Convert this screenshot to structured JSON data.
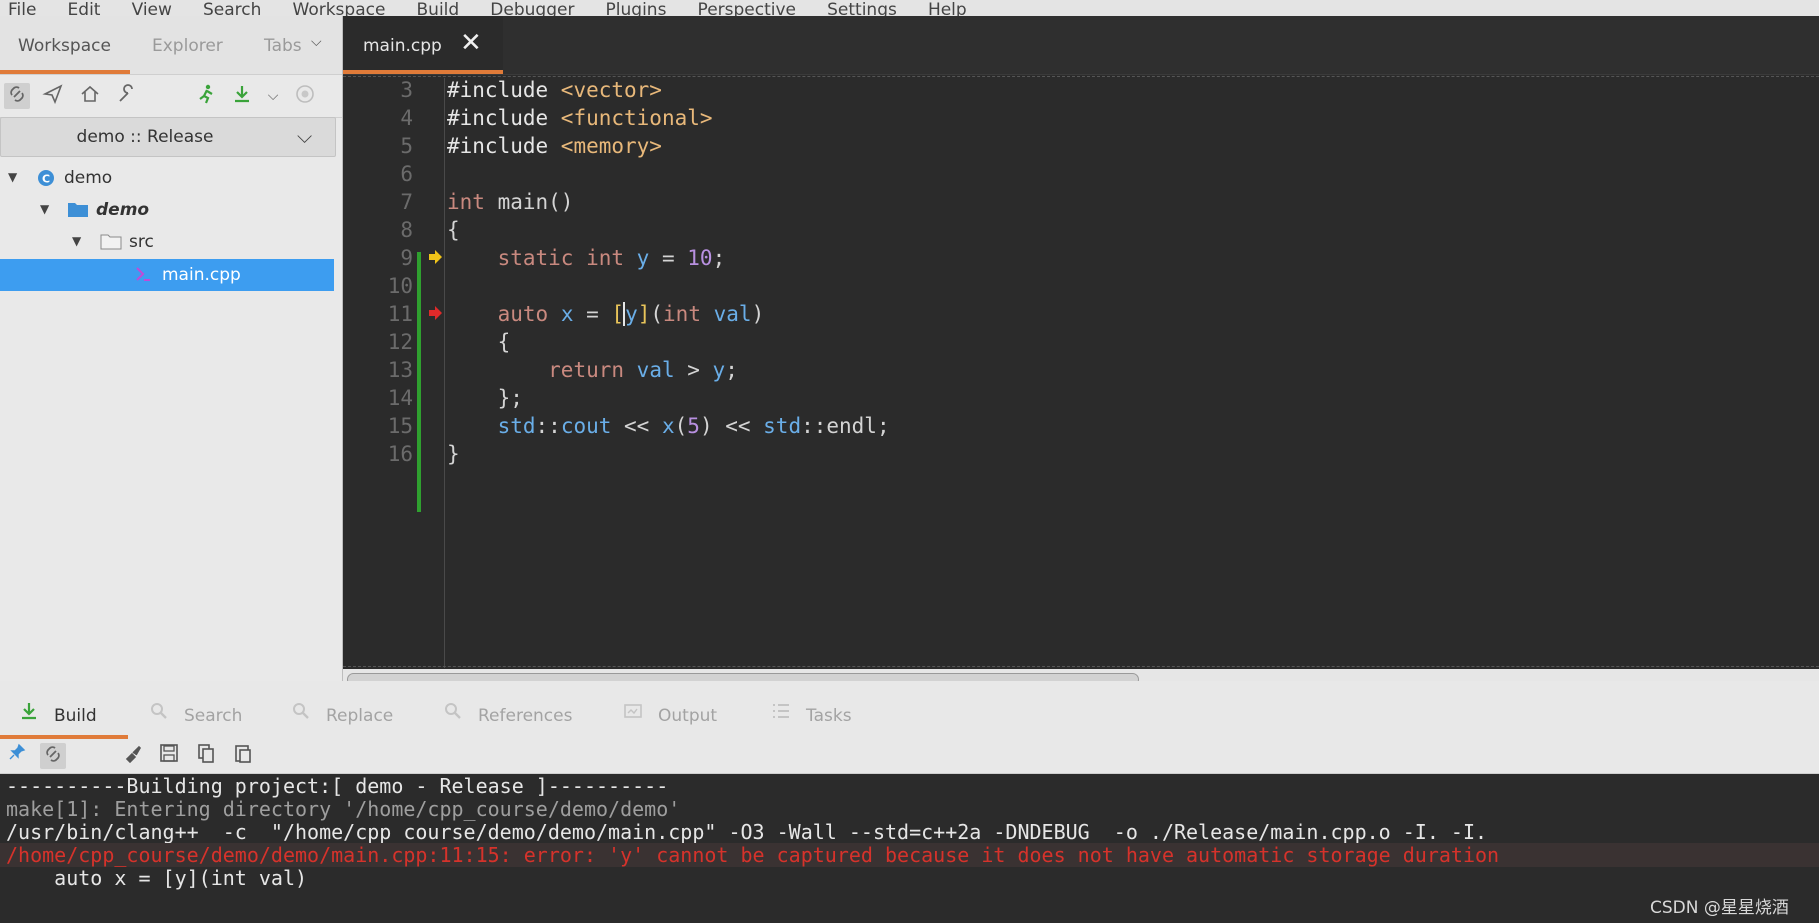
{
  "menu": [
    "File",
    "Edit",
    "View",
    "Search",
    "Workspace",
    "Build",
    "Debugger",
    "Plugins",
    "Perspective",
    "Settings",
    "Help"
  ],
  "left_panel": {
    "tabs": [
      "Workspace",
      "Explorer",
      "Tabs"
    ],
    "config": "demo :: Release",
    "tree": [
      {
        "label": "demo",
        "icon": "workspace-icon"
      },
      {
        "label": "demo",
        "icon": "project-folder-icon"
      },
      {
        "label": "src",
        "icon": "folder-icon"
      },
      {
        "label": "main.cpp",
        "icon": "cpp-file-icon"
      }
    ]
  },
  "editor": {
    "tab_label": "main.cpp",
    "line_numbers": [
      "3",
      "4",
      "5",
      "6",
      "7",
      "8",
      "9",
      "10",
      "11",
      "12",
      "13",
      "14",
      "15",
      "16"
    ]
  },
  "bottom_panel": {
    "tabs": [
      "Build",
      "Search",
      "Replace",
      "References",
      "Output",
      "Tasks"
    ],
    "output": [
      "----------Building project:[ demo - Release ]----------",
      "make[1]: Entering directory '/home/cpp_course/demo/demo'",
      "/usr/bin/clang++  -c  \"/home/cpp_course/demo/demo/main.cpp\" -O3 -Wall --std=c++2a -DNDEBUG  -o ./Release/main.cpp.o -I. -I.",
      "/home/cpp_course/demo/demo/main.cpp:11:15: error: 'y' cannot be captured because it does not have automatic storage duration",
      "    auto x = [y](int val)"
    ]
  },
  "watermark": "CSDN @星星烧酒",
  "colors": {
    "accent": "#e07b39",
    "selection": "#3d9df0",
    "error": "#d6322b",
    "change_bar": "#2fa02f"
  }
}
